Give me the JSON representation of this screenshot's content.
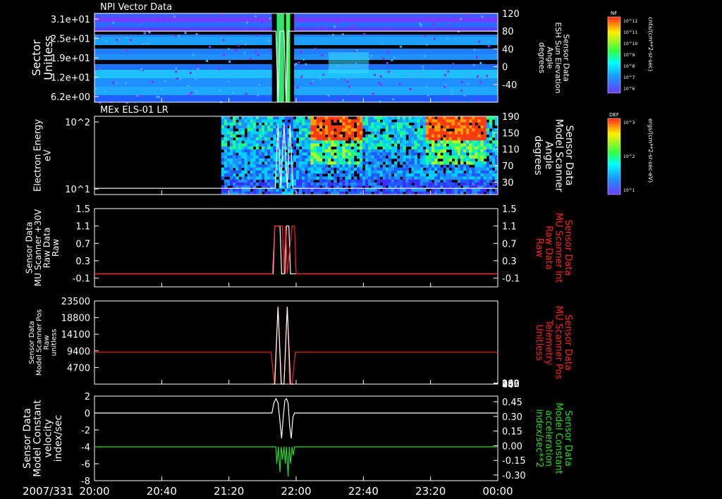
{
  "date_label": "2007/331",
  "x_ticks": [
    "20:00",
    "20:40",
    "21:20",
    "22:00",
    "22:40",
    "23:20",
    "00:00"
  ],
  "colorbars": [
    {
      "tag": "NF",
      "unit_label": "cnts/(cm**2-sr-sec)",
      "tick_labels": [
        "10^12",
        "10^11",
        "10^10",
        "10^9",
        "10^8",
        "10^7",
        "10^6"
      ],
      "stops": [
        "#ff2a1a",
        "#ffee00",
        "#33ff44",
        "#00ffff",
        "#1e90ff",
        "#6a3dff"
      ]
    },
    {
      "tag": "DEF",
      "unit_label": "ergs/(cm**2-sr-sec-eV)",
      "tick_labels": [
        "10^3",
        "10^2",
        "10^1"
      ],
      "stops": [
        "#ff2a1a",
        "#ffee00",
        "#33ff44",
        "#00ffff",
        "#1e90ff",
        "#6a3dff"
      ]
    }
  ],
  "chart_data": [
    {
      "type": "heatmap",
      "title": "NPI Vector Data",
      "ylabel": "Sector\nUnitless",
      "yticks": [
        "3.1e+01",
        "2.5e+01",
        "1.9e+01",
        "1.2e+01",
        "6.2e+00"
      ],
      "right_label": "Sensor Data\nESH Sun Elevation\nAngle\ndegrees",
      "right_ticks": [
        120,
        80,
        40,
        0,
        -40
      ],
      "right_ylim": [
        -80,
        120
      ],
      "overlay_series": [
        {
          "name": "ESH Sun Elevation Angle",
          "color": "#ffffff",
          "x": [
            0,
            0.45,
            0.455,
            0.46,
            0.47,
            0.475,
            0.48,
            0.49,
            0.495,
            1
          ],
          "y": [
            80,
            80,
            -80,
            80,
            80,
            -80,
            80,
            80,
            80,
            80
          ]
        }
      ]
    },
    {
      "type": "heatmap",
      "title": "MEx ELS-01 LR",
      "ylabel": "Electron Energy\neV",
      "yticks": [
        "10^2",
        "10^1"
      ],
      "right_label": "Sensor Data\nModel Scanner\nAngle\ndegrees",
      "right_ticks": [
        190,
        150,
        110,
        70,
        30
      ],
      "right_ylim": [
        0,
        190
      ],
      "overlay_series": [
        {
          "name": "Model Scanner Angle",
          "color": "#ffffff",
          "x": [
            0,
            0.448,
            0.455,
            0.462,
            0.47,
            0.478,
            0.485,
            0.492,
            0.5,
            1
          ],
          "y": [
            15,
            15,
            170,
            15,
            170,
            15,
            170,
            15,
            15,
            15
          ]
        }
      ]
    },
    {
      "type": "line",
      "ylabel": "Sensor Data\nMU Scanner +30V\nRaw Data\nRaw",
      "yticks": [
        1.5,
        1.1,
        0.7,
        0.3,
        -0.1
      ],
      "ylim": [
        -0.3,
        1.5
      ],
      "right_label": "Sensor Data\nMU Scanner Int\nRaw Data\nRaw",
      "right_ticks": [
        1.5,
        1.1,
        0.7,
        0.3,
        -0.1
      ],
      "series": [
        {
          "name": "MU Scanner +30V Raw Data",
          "color": "#ffffff",
          "x": [
            0,
            0.42,
            0.443,
            0.447,
            0.46,
            0.464,
            0.472,
            0.476,
            0.482,
            0.486,
            0.5,
            0.504,
            1
          ],
          "y": [
            0,
            0,
            0,
            1.1,
            1.1,
            0,
            0,
            1.1,
            1.1,
            0,
            0,
            0,
            0
          ]
        },
        {
          "name": "MU Scanner Int Raw Data",
          "color": "#ff2020",
          "x": [
            0,
            0.441,
            0.447,
            0.466,
            0.47,
            0.474,
            0.478,
            0.49,
            0.496,
            0.5,
            1
          ],
          "y": [
            0,
            0,
            1.1,
            1.1,
            0,
            1.1,
            0,
            1.1,
            1.1,
            0,
            0
          ]
        }
      ]
    },
    {
      "type": "line",
      "ylabel": "Sensor Data\nModel Scanner Pos\nRaw\nunitless",
      "yticks": [
        23500,
        18800,
        14100,
        9400,
        4700
      ],
      "ylim": [
        0,
        23500
      ],
      "right_label": "Sensor Data\nMU Scanner Pos\nTelemetry\nUnitless",
      "right_ticks": [
        260,
        206,
        152,
        98,
        44
      ],
      "series": [
        {
          "name": "MU Scanner Pos Telemetry",
          "color": "#ff2020",
          "x": [
            0,
            0.438,
            0.446,
            0.455,
            0.464,
            0.47,
            0.478,
            0.484,
            0.49,
            0.498,
            1
          ],
          "y": [
            9000,
            9000,
            0,
            22000,
            0,
            0,
            22000,
            0,
            0,
            9000,
            9000
          ]
        },
        {
          "name": "Model Scanner Pos Raw",
          "color": "#ffffff",
          "x": [
            0.44,
            0.447,
            0.455,
            0.463,
            0.47,
            0.478,
            0.486,
            0.494
          ],
          "y": [
            0,
            0,
            21800,
            0,
            0,
            21800,
            0,
            0
          ]
        }
      ]
    },
    {
      "type": "line",
      "ylabel": "Sensor Data\nModel Constant\nvelocity\nindex/sec",
      "yticks": [
        2,
        0,
        -2,
        -4,
        -6,
        -8
      ],
      "ylim": [
        -8,
        2
      ],
      "right_label": "Sensor Data\nModel Constant\nacceleration\nindex/sec**2",
      "right_ticks": [
        "0.45",
        "0.30",
        "0.15",
        "0.00",
        "-0.15",
        "-0.30"
      ],
      "series": [
        {
          "name": "Model Constant velocity",
          "color": "#ffffff",
          "x": [
            0,
            0.44,
            0.445,
            0.45,
            0.455,
            0.46,
            0.464,
            0.468,
            0.472,
            0.476,
            0.48,
            0.484,
            0.488,
            0.492,
            0.496,
            1
          ],
          "y": [
            0,
            0,
            1.2,
            1.7,
            1.2,
            -1,
            -3,
            -0.5,
            1.5,
            1.7,
            1.2,
            -1.5,
            -3,
            -0.5,
            0,
            0
          ]
        },
        {
          "name": "Model Constant acceleration",
          "color": "#22dd22",
          "x": [
            0,
            0.45,
            0.452,
            0.456,
            0.46,
            0.463,
            0.466,
            0.47,
            0.473,
            0.476,
            0.48,
            0.483,
            0.486,
            0.49,
            0.493,
            0.496,
            1
          ],
          "y": [
            -4,
            -4,
            -6,
            -4,
            -7,
            -4,
            -5.5,
            -4,
            -6,
            -4,
            -7.5,
            -4,
            -6,
            -4,
            -5,
            -4,
            -4
          ]
        }
      ]
    }
  ]
}
